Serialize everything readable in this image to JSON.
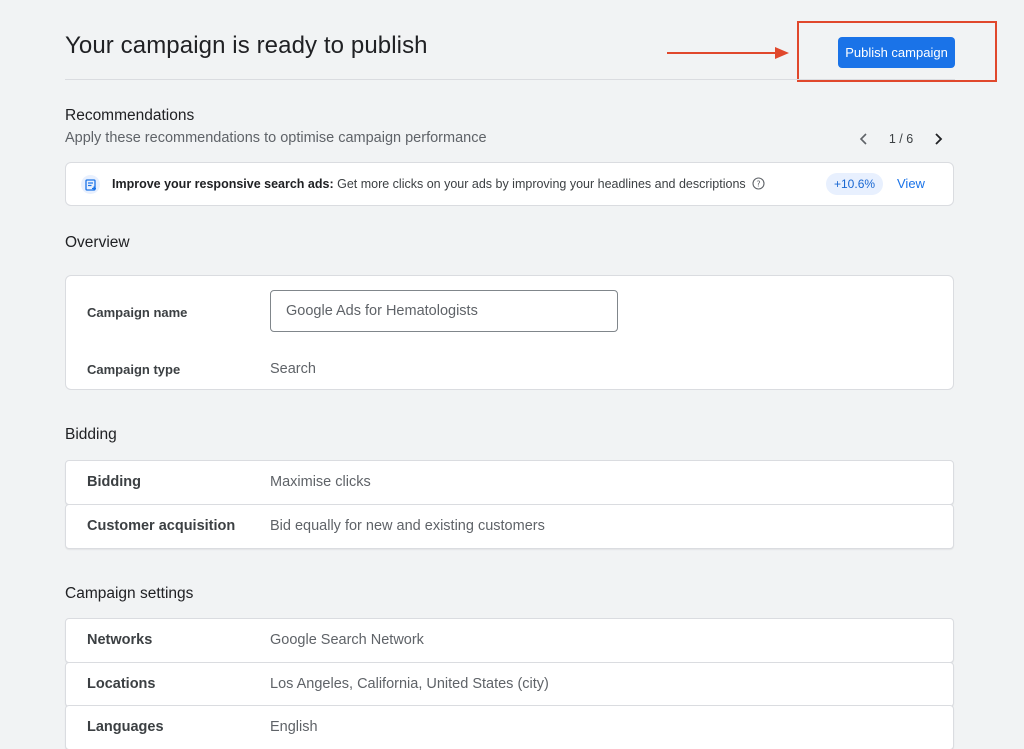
{
  "header": {
    "title": "Your campaign is ready to publish",
    "publish_label": "Publish campaign",
    "annotation_color": "#e0482c",
    "accent_color": "#1a73e8"
  },
  "recommendations": {
    "heading": "Recommendations",
    "subtitle": "Apply these recommendations to optimise campaign performance",
    "pager": {
      "current": "1 / 6"
    },
    "card": {
      "icon": "responsive-ad-icon",
      "title": "Improve your responsive search ads:",
      "description": "Get more clicks on your ads by improving your headlines and descriptions",
      "uplift": "+10.6%",
      "action": "View"
    }
  },
  "overview": {
    "heading": "Overview",
    "campaign_name_label": "Campaign name",
    "campaign_name_value": "Google Ads for Hematologists",
    "campaign_type_label": "Campaign type",
    "campaign_type_value": "Search"
  },
  "bidding": {
    "heading": "Bidding",
    "rows": [
      {
        "label": "Bidding",
        "value": "Maximise clicks"
      },
      {
        "label": "Customer acquisition",
        "value": "Bid equally for new and existing customers"
      }
    ]
  },
  "settings": {
    "heading": "Campaign settings",
    "rows": [
      {
        "label": "Networks",
        "value": "Google Search Network"
      },
      {
        "label": "Locations",
        "value": "Los Angeles, California, United States (city)"
      },
      {
        "label": "Languages",
        "value": "English"
      }
    ]
  }
}
